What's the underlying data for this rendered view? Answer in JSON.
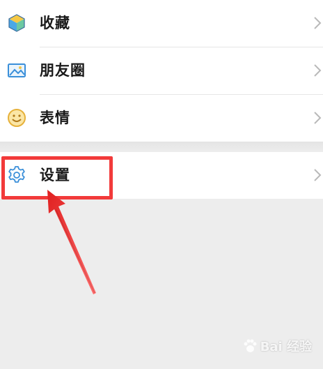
{
  "menu": {
    "items": [
      {
        "label": "收藏",
        "icon": "favorites-cube-icon"
      },
      {
        "label": "朋友圈",
        "icon": "moments-photo-icon"
      },
      {
        "label": "表情",
        "icon": "sticker-smiley-icon"
      }
    ],
    "settings": {
      "label": "设置",
      "icon": "gear-icon"
    }
  },
  "colors": {
    "accent_blue": "#3a8fd9",
    "highlight_red": "#f23a3a",
    "smiley_yellow": "#f0c64c",
    "page_bg": "#ededed"
  },
  "watermark": {
    "text": "Bai 经验",
    "brand": "Baidu"
  }
}
